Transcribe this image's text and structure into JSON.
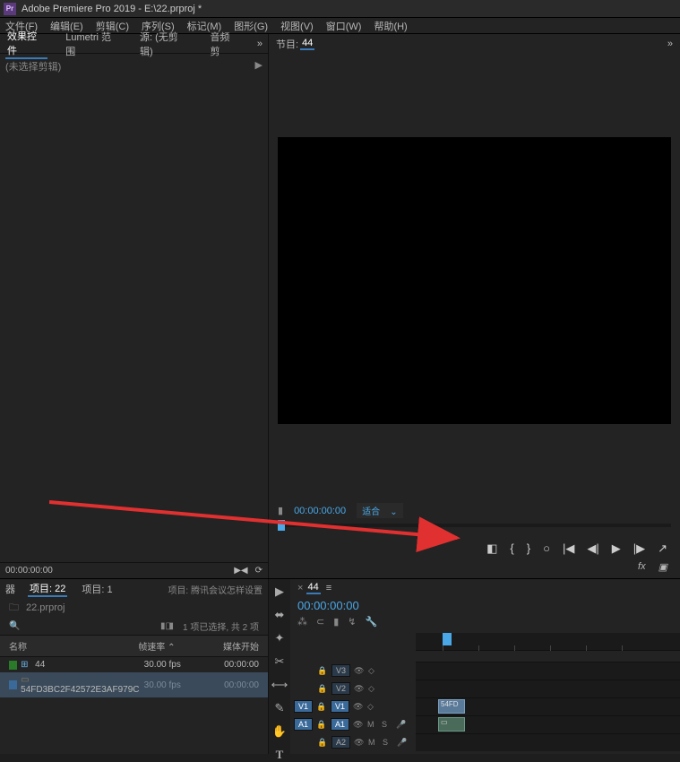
{
  "app": {
    "icon_text": "Pr",
    "title": "Adobe Premiere Pro 2019 - E:\\22.prproj *"
  },
  "menu": [
    "文件(F)",
    "编辑(E)",
    "剪辑(C)",
    "序列(S)",
    "标记(M)",
    "图形(G)",
    "视图(V)",
    "窗口(W)",
    "帮助(H)"
  ],
  "effects": {
    "tabs": [
      "效果控件",
      "Lumetri 范围",
      "源: (无剪辑)",
      "音频剪"
    ],
    "active_index": 0,
    "empty_text": "(未选择剪辑)",
    "footer_time": "00:00:00:00"
  },
  "program": {
    "tab_prefix": "节目:",
    "sequence_name": "44",
    "time_left": "00:00:00:00",
    "fit_label": "适合"
  },
  "project": {
    "tabs_prefix": "器",
    "tab1": "项目: 22",
    "tab2": "项目: 1",
    "info_text": "项目: 腾讯会议怎样设置",
    "proj_name": "22.prproj",
    "selection_text": "1 项已选择, 共 2 项",
    "columns": {
      "name": "名称",
      "fps": "帧速率",
      "media": "媒体开始"
    },
    "rows": [
      {
        "color": "#2a7a2a",
        "icon_class": "seq-icon",
        "name": "44",
        "fps": "30.00 fps",
        "media": "00:00:00",
        "selected": false
      },
      {
        "color": "#3a6a9a",
        "icon_class": "clip-icon",
        "name": "54FD3BC2F42572E3AF979C",
        "fps": "30.00 fps",
        "media": "00:00:00",
        "selected": true
      }
    ]
  },
  "timeline": {
    "seq_name": "44",
    "timecode": "00:00:00:00",
    "tracks": {
      "v3": "V3",
      "v2": "V2",
      "v1": "V1",
      "a1": "A1",
      "a2": "A2"
    },
    "toggles": {
      "mute": "M",
      "solo": "S"
    },
    "clip_label": "54FD"
  },
  "fx_label": "fx",
  "transport_icons": [
    "◧",
    "{",
    "}",
    "○",
    "|◀",
    "◀|",
    "▶",
    "|▶",
    "↗"
  ]
}
